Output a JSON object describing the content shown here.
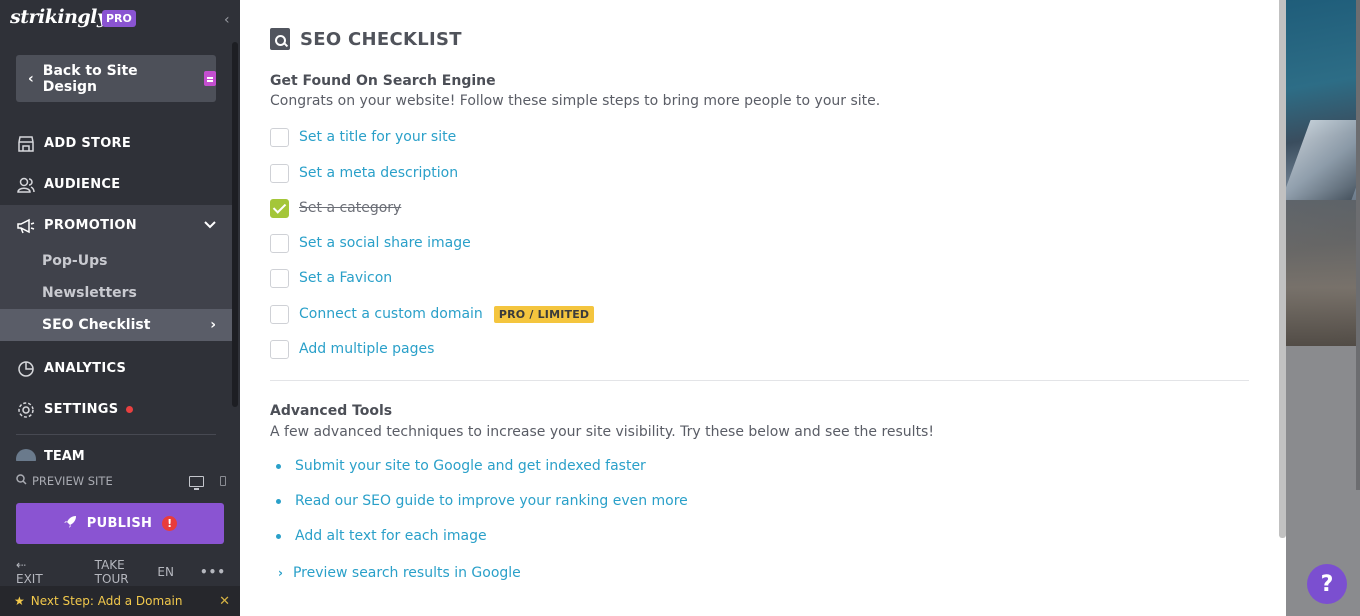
{
  "sidebar": {
    "logo": "strikingly",
    "pro_badge": "PRO",
    "back_button": "Back to Site Design",
    "nav": {
      "add_store": "ADD STORE",
      "audience": "AUDIENCE",
      "promotion": "PROMOTION",
      "analytics": "ANALYTICS",
      "settings": "SETTINGS",
      "team": "TEAM"
    },
    "promotion_sub": {
      "popups": "Pop-Ups",
      "newsletters": "Newsletters",
      "seo_checklist": "SEO Checklist"
    },
    "preview_site": "PREVIEW SITE",
    "publish": "PUBLISH",
    "publish_alert": "!",
    "bottom": {
      "exit": "EXIT",
      "take_tour": "TAKE TOUR",
      "language": "EN",
      "more": "•••"
    },
    "next_step": "Next Step: Add a Domain"
  },
  "main": {
    "title": "SEO CHECKLIST",
    "section1": {
      "heading": "Get Found On Search Engine",
      "description": "Congrats on your website! Follow these simple steps to bring more people to your site.",
      "items": [
        {
          "label": "Set a title for your site",
          "checked": false
        },
        {
          "label": "Set a meta description",
          "checked": false
        },
        {
          "label": "Set a category",
          "checked": true
        },
        {
          "label": "Set a social share image",
          "checked": false
        },
        {
          "label": "Set a Favicon",
          "checked": false
        },
        {
          "label": "Connect a custom domain",
          "checked": false,
          "tag": "PRO / LIMITED"
        },
        {
          "label": "Add multiple pages",
          "checked": false
        }
      ]
    },
    "section2": {
      "heading": "Advanced Tools",
      "description": "A few advanced techniques to increase your site visibility. Try these below and see the results!",
      "links": [
        "Submit your site to Google and get indexed faster",
        "Read our SEO guide to improve your ranking even more",
        "Add alt text for each image"
      ],
      "expand_link": "Preview search results in Google"
    }
  },
  "help": "?",
  "colors": {
    "sidebar_bg": "#2f3138",
    "accent_purple": "#8a54d2",
    "link_blue": "#2aa0c9",
    "check_green": "#a4c639",
    "tag_yellow": "#f4c53e",
    "alert_red": "#e93c3c"
  }
}
